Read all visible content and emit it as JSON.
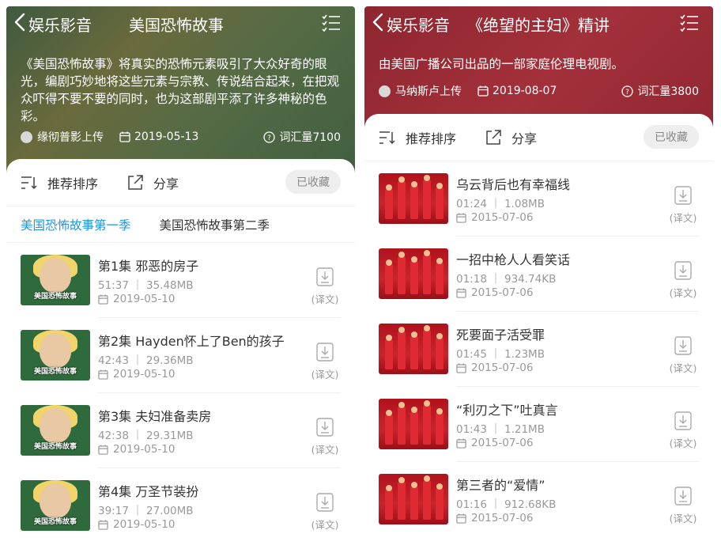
{
  "left": {
    "back_label": "娱乐影音",
    "title": "美国恐怖故事",
    "description": "《美国恐怖故事》将真实的恐怖元素吸引了大众好奇的眼光，编剧巧妙地将这些元素与宗教、传说结合起来，在把观众吓得不要不要的同时，也为这部剧平添了许多神秘的色彩。",
    "uploader": "缘彻普影上传",
    "date": "2019-05-13",
    "vocab": "词汇量7100",
    "sort_label": "推荐排序",
    "share_label": "分享",
    "fav_label": "已收藏",
    "tabs": [
      "美国恐怖故事第一季",
      "美国恐怖故事第二季"
    ],
    "thumb_text": "美国恐怖故事",
    "episodes": [
      {
        "title": "第1集 邪恶的房子",
        "sub": "51:37 ｜ 35.48MB",
        "date": "2019-05-10",
        "dl": "(译文)"
      },
      {
        "title": "第2集 Hayden怀上了Ben的孩子",
        "sub": "42:43 ｜ 29.36MB",
        "date": "2019-05-10",
        "dl": "(译文)"
      },
      {
        "title": "第3集 夫妇准备卖房",
        "sub": "42:38 ｜ 29.31MB",
        "date": "2019-05-10",
        "dl": "(译文)"
      },
      {
        "title": "第4集 万圣节装扮",
        "sub": "39:17 ｜ 27.00MB",
        "date": "2019-05-10",
        "dl": "(译文)"
      }
    ]
  },
  "right": {
    "back_label": "娱乐影音",
    "title": "《绝望的主妇》精讲",
    "description": "由美国广播公司出品的一部家庭伦理电视剧。",
    "uploader": "马纳斯卢上传",
    "date": "2019-08-07",
    "vocab": "词汇量3800",
    "sort_label": "推荐排序",
    "share_label": "分享",
    "fav_label": "已收藏",
    "episodes": [
      {
        "title": "乌云背后也有幸福线",
        "sub": "01:24 ｜ 1.08MB",
        "date": "2015-07-06",
        "dl": "(译文)"
      },
      {
        "title": "一招中枪人人看笑话",
        "sub": "01:18 ｜ 934.74KB",
        "date": "2015-07-06",
        "dl": "(译文)"
      },
      {
        "title": "死要面子活受罪",
        "sub": "01:45 ｜ 1.23MB",
        "date": "2015-07-06",
        "dl": "(译文)"
      },
      {
        "title": "“利刃之下”吐真言",
        "sub": "01:43 ｜ 1.21MB",
        "date": "2015-07-06",
        "dl": "(译文)"
      },
      {
        "title": "第三者的“爱情”",
        "sub": "01:16 ｜ 912.68KB",
        "date": "2015-07-06",
        "dl": "(译文)"
      }
    ]
  },
  "colors": {
    "active_tab": "#2196e0",
    "left_header": "#4a5f40",
    "right_header": "#9a2a34"
  }
}
